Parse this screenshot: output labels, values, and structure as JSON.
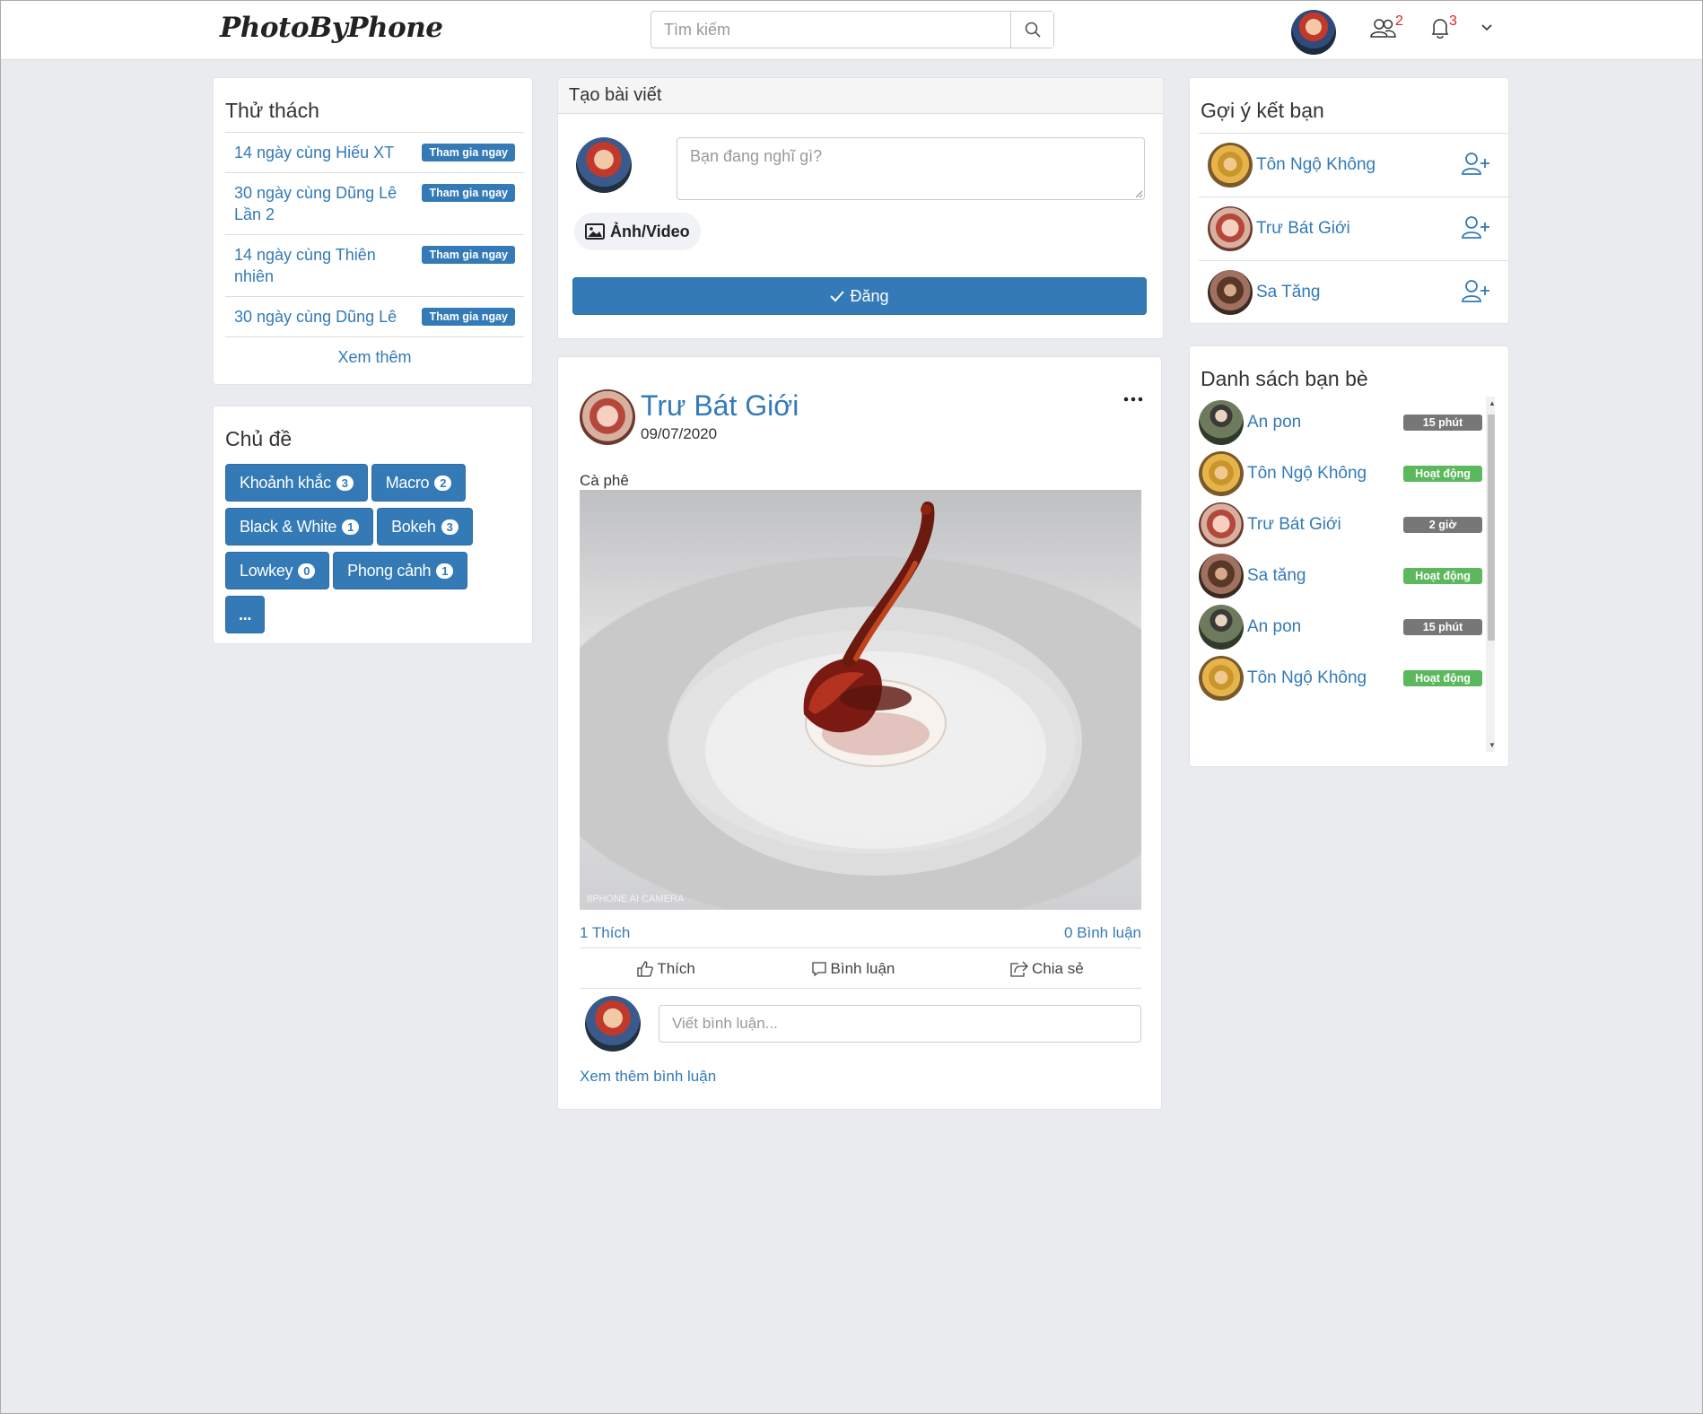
{
  "navbar": {
    "logo": "PhotoByPhone",
    "search_placeholder": "Tìm kiếm",
    "friend_requests_count": "2",
    "notifications_count": "3"
  },
  "challenges": {
    "title": "Thử thách",
    "items": [
      {
        "name": "14 ngày cùng Hiếu XT",
        "action": "Tham gia ngay"
      },
      {
        "name": "30 ngày cùng Dũng Lê Lần 2",
        "action": "Tham gia ngay"
      },
      {
        "name": "14 ngày cùng Thiên nhiên",
        "action": "Tham gia ngay"
      },
      {
        "name": "30 ngày cùng Dũng Lê",
        "action": "Tham gia ngay"
      }
    ],
    "see_more": "Xem thêm"
  },
  "topics": {
    "title": "Chủ đề",
    "items": [
      {
        "label": "Khoảnh khắc",
        "count": "3"
      },
      {
        "label": "Macro",
        "count": "2"
      },
      {
        "label": "Black & White",
        "count": "1"
      },
      {
        "label": "Bokeh",
        "count": "3"
      },
      {
        "label": "Lowkey",
        "count": "0"
      },
      {
        "label": "Phong cảnh",
        "count": "1"
      }
    ],
    "more_label": "..."
  },
  "create_post": {
    "title": "Tạo bài viết",
    "placeholder": "Bạn đang nghĩ gì?",
    "media_label": "Ảnh/Video",
    "submit_label": "Đăng"
  },
  "post": {
    "author": "Trư Bát Giới",
    "date": "09/07/2020",
    "caption": "Cà phê",
    "watermark": "8PHONE AI CAMERA",
    "likes": "1 Thích",
    "comments": "0 Bình luận",
    "like_label": "Thích",
    "comment_label": "Bình luận",
    "share_label": "Chia sẻ",
    "comment_placeholder": "Viết bình luận...",
    "more_comments": "Xem thêm bình luận"
  },
  "suggestions": {
    "title": "Gợi ý kết bạn",
    "items": [
      {
        "name": "Tôn Ngộ Không",
        "avatar": "wukong"
      },
      {
        "name": "Trư Bát Giới",
        "avatar": "bajie"
      },
      {
        "name": "Sa Tăng",
        "avatar": "sa"
      }
    ]
  },
  "friends": {
    "title": "Danh sách bạn bè",
    "items": [
      {
        "name": "An pon",
        "status": "15 phút",
        "online": false,
        "avatar": "anpon"
      },
      {
        "name": "Tôn Ngộ Không",
        "status": "Hoạt động",
        "online": true,
        "avatar": "wukong"
      },
      {
        "name": "Trư Bát Giới",
        "status": "2 giờ",
        "online": false,
        "avatar": "bajie"
      },
      {
        "name": "Sa tăng",
        "status": "Hoạt động",
        "online": true,
        "avatar": "sa"
      },
      {
        "name": "An pon",
        "status": "15 phút",
        "online": false,
        "avatar": "anpon"
      },
      {
        "name": "Tôn Ngộ Không",
        "status": "Hoạt động",
        "online": true,
        "avatar": "wukong"
      }
    ]
  },
  "colors": {
    "primary": "#337ab7",
    "online": "#5cb85c",
    "offline": "#777777",
    "background": "#e9ebee",
    "badge_red": "#e32222"
  }
}
